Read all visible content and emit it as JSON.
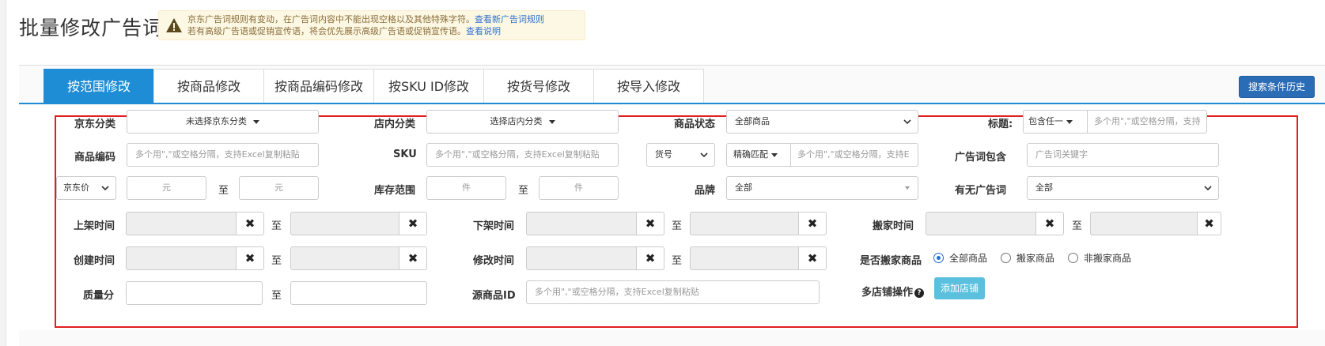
{
  "page_title": "批量修改广告词",
  "notice": {
    "line1": "京东广告词规则有变动，在广告词内容中不能出现空格以及其他特殊字符。",
    "link1": "查看新广告词规则",
    "line2": "若有高级广告语或促销宣传语，将会优先展示高级广告语或促销宣传语。",
    "link2": "查看说明"
  },
  "tabs": [
    "按范围修改",
    "按商品修改",
    "按商品编码修改",
    "按SKU ID修改",
    "按货号修改",
    "按导入修改"
  ],
  "history_button": "搜索条件历史",
  "filters": {
    "jd_category": {
      "label": "京东分类",
      "value": "未选择京东分类"
    },
    "shop_category": {
      "label": "店内分类",
      "value": "选择店内分类"
    },
    "item_status": {
      "label": "商品状态",
      "value": "全部商品"
    },
    "title": {
      "label": "标题:",
      "mode": "包含任一",
      "placeholder": "多个用\",\"或空格分隔，支持"
    },
    "item_code": {
      "label": "商品编码",
      "placeholder": "多个用\",\"或空格分隔，支持Excel复制粘贴"
    },
    "sku": {
      "label": "SKU",
      "placeholder": "多个用\",\"或空格分隔，支持Excel复制粘贴"
    },
    "huohao": {
      "select": "货号",
      "mode": "精确匹配",
      "placeholder": "多个用\",\"或空格分隔，支持E"
    },
    "ad_word_contains": {
      "label": "广告词包含",
      "placeholder": "广告词关键字"
    },
    "price": {
      "select": "京东价",
      "from_placeholder": "元",
      "to_label": "至",
      "to_placeholder": "元"
    },
    "stock_range": {
      "label": "库存范围",
      "from_placeholder": "件",
      "to_label": "至",
      "to_placeholder": "件"
    },
    "brand": {
      "label": "品牌",
      "value": "全部"
    },
    "has_ad_word": {
      "label": "有无广告词",
      "value": "全部"
    },
    "listing_time": {
      "label": "上架时间",
      "to_label": "至"
    },
    "delisting_time": {
      "label": "下架时间",
      "to_label": "至"
    },
    "move_time": {
      "label": "搬家时间",
      "to_label": "至"
    },
    "create_time": {
      "label": "创建时间",
      "to_label": "至"
    },
    "modify_time": {
      "label": "修改时间",
      "to_label": "至"
    },
    "is_moved": {
      "label": "是否搬家商品",
      "options": [
        "全部商品",
        "搬家商品",
        "非搬家商品"
      ],
      "selected": "全部商品"
    },
    "quality_score": {
      "label": "质量分",
      "to_label": "至"
    },
    "source_item_id": {
      "label": "源商品ID",
      "placeholder": "多个用\",\"或空格分隔，支持Excel复制粘贴"
    },
    "multi_shop": {
      "label": "多店铺操作",
      "help": "?",
      "button": "添加店铺"
    }
  },
  "colors": {
    "tab_active": "#1f8dd6",
    "history_button": "#2a6cb5",
    "highlight_border": "#e02020",
    "add_button": "#5bc0de"
  }
}
